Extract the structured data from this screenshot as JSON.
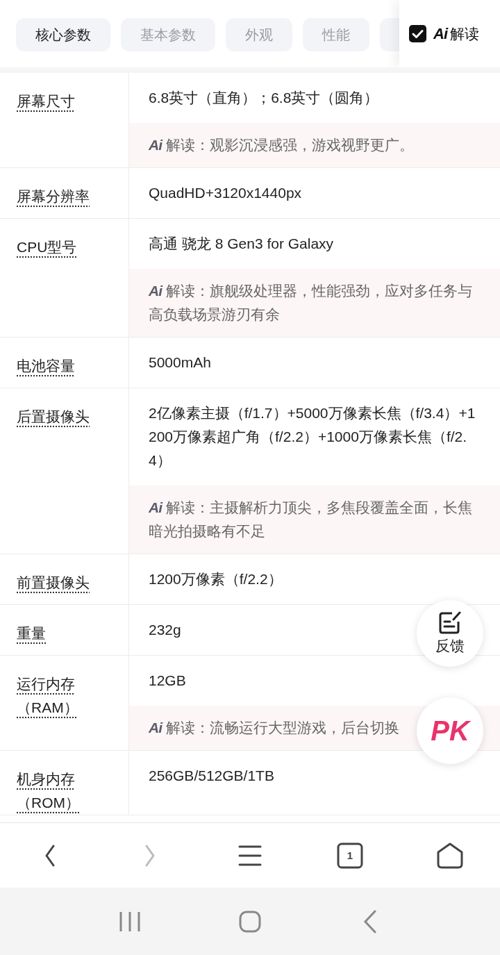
{
  "tabs": [
    {
      "label": "核心参数",
      "selected": true
    },
    {
      "label": "基本参数",
      "selected": false
    },
    {
      "label": "外观",
      "selected": false
    },
    {
      "label": "性能",
      "selected": false
    },
    {
      "selected": false
    }
  ],
  "ai_toggle": {
    "checked": true,
    "logo": "Ai",
    "label": "解读"
  },
  "specs": [
    {
      "label": "屏幕尺寸",
      "value": "6.8英寸（直角）；6.8英寸（圆角）",
      "ai": {
        "text": "**Ai** 解读：观影沉浸感强，游戏视野更广。"
      }
    },
    {
      "label": "屏幕分辨率",
      "value": "QuadHD+3120x1440px"
    },
    {
      "label": "CPU型号",
      "value": "高通 骁龙 8 Gen3 for Galaxy",
      "ai": {
        "text": "**Ai** 解读：旗舰级处理器，性能强劲，应对多任务与高负载场景游刃有余"
      }
    },
    {
      "label": "电池容量",
      "value": "5000mAh"
    },
    {
      "label": "后置摄像头",
      "value": "2亿像素主摄（f/1.7）+5000万像素长焦（f/3.4）+1200万像素超广角（f/2.2）+1000万像素长焦（f/2.4）",
      "ai": {
        "text": "**Ai** 解读：主摄解析力顶尖，多焦段覆盖全面，长焦暗光拍摄略有不足"
      }
    },
    {
      "label": "前置摄像头",
      "value": "1200万像素（f/2.2）"
    },
    {
      "label": "重量",
      "value": "232g"
    },
    {
      "label": "运行内存（RAM）",
      "value": "12GB",
      "ai": {
        "text": "**Ai** 解读：流畅运行大型游戏，后台切换"
      }
    },
    {
      "label": "机身内存（ROM）",
      "value": "256GB/512GB/1TB"
    }
  ],
  "feedback_button": {
    "label": "反馈"
  },
  "pk_button": {
    "label": "PK"
  },
  "browser_bar": [
    {
      "kind": "back",
      "disabled": false
    },
    {
      "kind": "forward",
      "disabled": true
    },
    {
      "kind": "menu",
      "disabled": false
    },
    {
      "kind": "tabs",
      "disabled": false,
      "count": "1"
    },
    {
      "kind": "home",
      "disabled": false
    }
  ],
  "system_nav": [
    {
      "kind": "recents"
    },
    {
      "kind": "home"
    },
    {
      "kind": "back"
    }
  ]
}
